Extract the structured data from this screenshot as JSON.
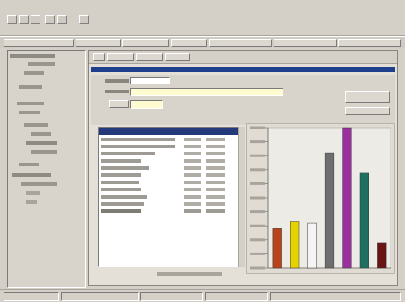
{
  "colors": {
    "face": "#d4d0c8",
    "title_bar": "#1d3f8c",
    "header_row": "#243a7a",
    "yellow_field": "#fffbd0",
    "bar_red": "#b8431d",
    "bar_yellow": "#e6d200",
    "bar_white": "#f4f4f4",
    "bar_gray": "#6e6e6e",
    "bar_magenta": "#9b2fa0",
    "bar_teal": "#1e6f60",
    "bar_darkred": "#6a1414"
  },
  "icons": [
    "back-icon",
    "forward-icon",
    "print-icon",
    "save-icon",
    "refresh-icon",
    "help-icon"
  ],
  "chart_data": {
    "type": "bar",
    "title": "",
    "xlabel": "",
    "ylabel": "",
    "ylim": [
      0,
      100
    ],
    "categories": [
      "",
      "",
      "",
      "",
      "",
      "",
      ""
    ],
    "values": [
      28,
      33,
      32,
      82,
      100,
      68,
      18
    ],
    "colors": [
      "#b8431d",
      "#e6d200",
      "#f4f4f4",
      "#6e6e6e",
      "#9b2fa0",
      "#1e6f60",
      "#6a1414"
    ]
  }
}
